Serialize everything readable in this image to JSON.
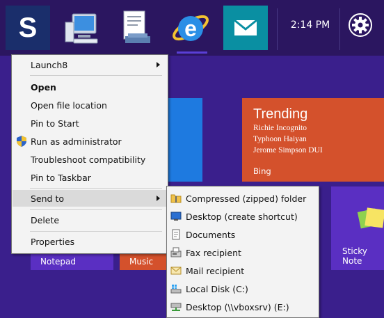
{
  "taskbar": {
    "clock": "2:14 PM",
    "apps": [
      {
        "name": "softpedia-app",
        "letter": "S"
      },
      {
        "name": "computer"
      },
      {
        "name": "document-viewer"
      },
      {
        "name": "internet-explorer",
        "letter": "e"
      },
      {
        "name": "mail"
      }
    ]
  },
  "tiles": {
    "trending": {
      "title": "Trending",
      "items": [
        "Richie Incognito",
        "Typhoon Haiyan",
        "Jerome Simpson DUI"
      ],
      "source": "Bing"
    },
    "notepad": "Notepad",
    "music": "Music",
    "sticky_notes": "Sticky Note"
  },
  "context_menu": {
    "items": [
      {
        "label": "Launch8",
        "submenu": true
      },
      {
        "label": "Open",
        "bold": true
      },
      {
        "label": "Open file location"
      },
      {
        "label": "Pin to Start"
      },
      {
        "label": "Run as administrator",
        "icon": "uac-shield-icon"
      },
      {
        "label": "Troubleshoot compatibility"
      },
      {
        "label": "Pin to Taskbar"
      },
      {
        "label": "Send to",
        "submenu": true,
        "selected": true
      },
      {
        "label": "Delete"
      },
      {
        "label": "Properties"
      }
    ]
  },
  "send_to_menu": {
    "items": [
      {
        "label": "Compressed (zipped) folder",
        "icon": "zip-folder-icon"
      },
      {
        "label": "Desktop (create shortcut)",
        "icon": "desktop-icon"
      },
      {
        "label": "Documents",
        "icon": "documents-icon"
      },
      {
        "label": "Fax recipient",
        "icon": "fax-icon"
      },
      {
        "label": "Mail recipient",
        "icon": "mail-recipient-icon"
      },
      {
        "label": "Local Disk (C:)",
        "icon": "local-disk-icon"
      },
      {
        "label": "Desktop (\\\\vboxsrv) (E:)",
        "icon": "network-drive-icon"
      }
    ]
  },
  "colors": {
    "start_bg": "#3a1f8c",
    "taskbar_bg": "#2b1660",
    "trending_tile": "#d4512c",
    "blue_tile": "#1e7ae0",
    "notepad_tile": "#5a2fc2",
    "music_tile": "#d4512c",
    "mail_tile": "#0a8fa2"
  }
}
